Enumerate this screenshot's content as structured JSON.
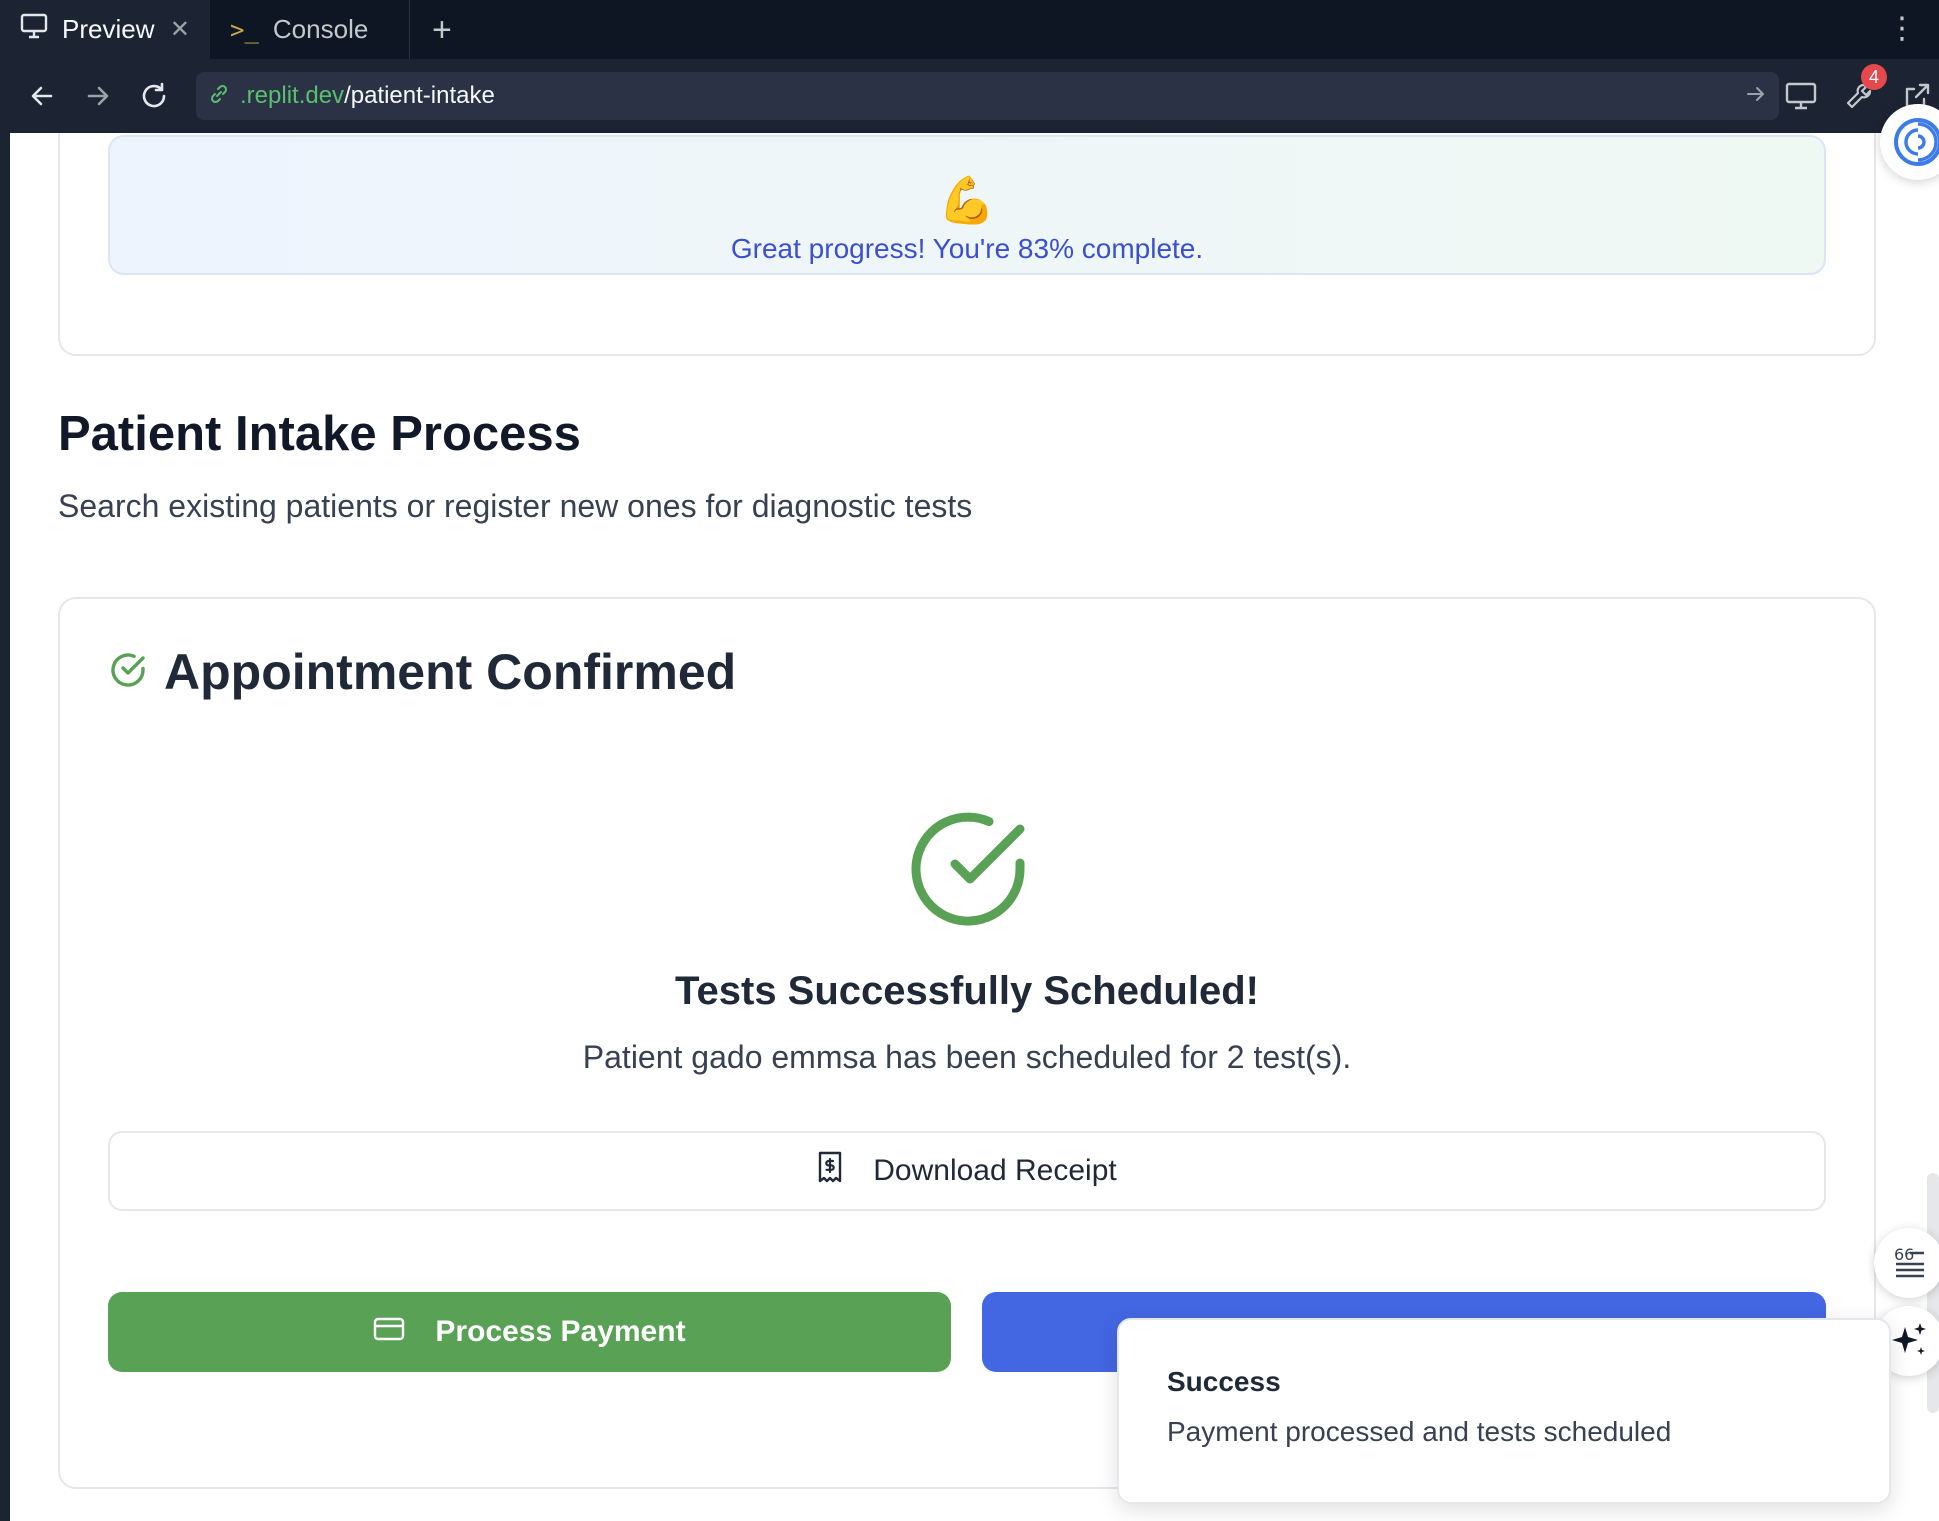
{
  "browser": {
    "tabs": [
      {
        "label": "Preview",
        "icon": "monitor-icon",
        "active": true
      },
      {
        "label": "Console",
        "icon": "terminal-icon",
        "active": false
      }
    ],
    "url_domain": ".replit.dev",
    "url_path": "/patient-intake",
    "devtools_badge": "4"
  },
  "progress": {
    "emoji": "💪",
    "message": "Great progress! You're 83% complete.",
    "percent_complete": 83
  },
  "section": {
    "title": "Patient Intake Process",
    "subtitle": "Search existing patients or register new ones for diagnostic tests"
  },
  "confirmation": {
    "title": "Appointment Confirmed",
    "success_title": "Tests Successfully Scheduled!",
    "success_message": "Patient gado emmsa has been scheduled for 2 test(s).",
    "download_receipt_label": "Download Receipt",
    "process_payment_label": "Process Payment"
  },
  "toast": {
    "title": "Success",
    "message": "Payment processed and tests scheduled"
  },
  "colors": {
    "success_green": "#58a155",
    "primary_blue": "#4366e3",
    "progress_text": "#3b4fcf"
  }
}
